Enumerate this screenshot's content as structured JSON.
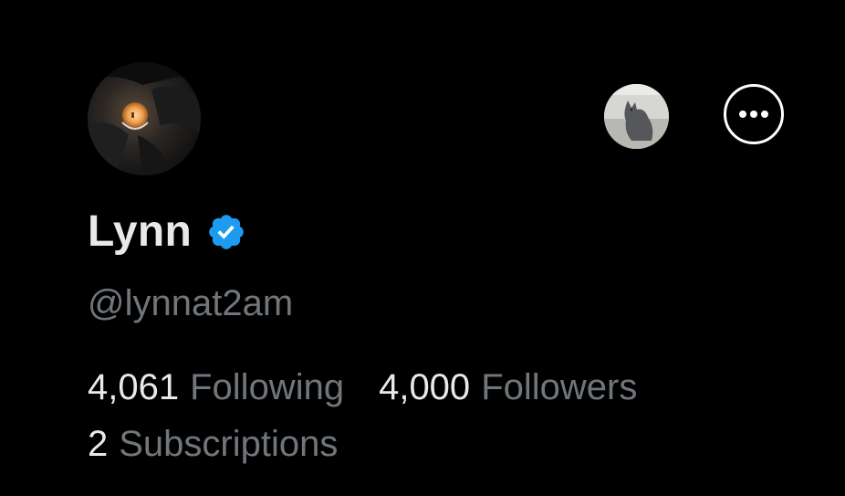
{
  "profile": {
    "display_name": "Lynn",
    "handle": "@lynnat2am",
    "verified": true,
    "avatar_icon": "avatar-image",
    "secondary_avatar_icon": "cat-avatar-image",
    "more_icon": "more-options-icon"
  },
  "stats": {
    "following_count": "4,061",
    "following_label": "Following",
    "followers_count": "4,000",
    "followers_label": "Followers",
    "subscriptions_count": "2",
    "subscriptions_label": "Subscriptions"
  },
  "colors": {
    "background": "#000000",
    "primary_text": "#e7e9ea",
    "secondary_text": "#71767b",
    "verified_blue": "#1d9bf0"
  }
}
